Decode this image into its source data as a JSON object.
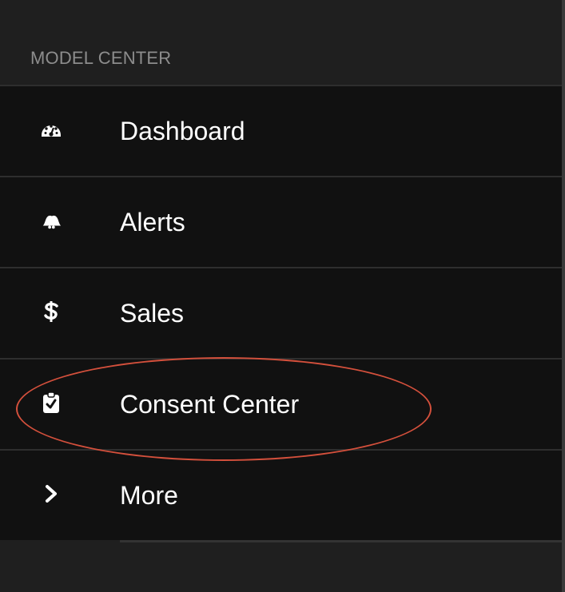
{
  "sidebar": {
    "section_header": "MODEL CENTER",
    "items": [
      {
        "label": "Dashboard",
        "icon": "dashboard-gauge-icon"
      },
      {
        "label": "Alerts",
        "icon": "bell-icon"
      },
      {
        "label": "Sales",
        "icon": "dollar-icon"
      },
      {
        "label": "Consent Center",
        "icon": "clipboard-check-icon"
      },
      {
        "label": "More",
        "icon": "chevron-right-icon"
      }
    ]
  },
  "highlight": {
    "color": "#d4503c",
    "target": "Consent Center"
  },
  "colors": {
    "panel_background": "#1f1f1f",
    "item_background": "#111111",
    "text": "#ffffff",
    "header_text": "#8d8d8d"
  }
}
